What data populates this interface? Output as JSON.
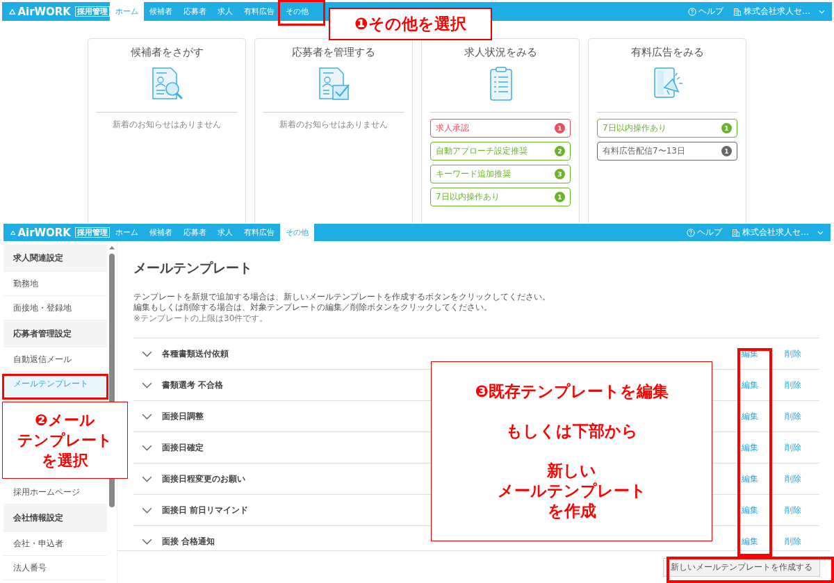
{
  "top_screen": {
    "header": {
      "logo": "AirWORK",
      "badge": "採用管理",
      "tabs": [
        {
          "label": "ホーム",
          "selected": true
        },
        {
          "label": "候補者",
          "selected": false
        },
        {
          "label": "応募者",
          "selected": false
        },
        {
          "label": "求人",
          "selected": false
        },
        {
          "label": "有料広告",
          "selected": false
        },
        {
          "label": "その他",
          "selected": false
        }
      ],
      "help": "ヘルプ",
      "account": "株式会社求人セ…"
    },
    "cards": [
      {
        "title": "候補者をさがす",
        "notice": "新着のお知らせはありません"
      },
      {
        "title": "応募者を管理する",
        "notice": "新着のお知らせはありません"
      },
      {
        "title": "求人状況をみる",
        "items": [
          {
            "label": "求人承認",
            "count": "1",
            "color": "#e8505b"
          },
          {
            "label": "自動アプローチ設定推奨",
            "count": "2",
            "color": "#6ab42d"
          },
          {
            "label": "キーワード追加推奨",
            "count": "3",
            "color": "#6ab42d"
          },
          {
            "label": "7日以内操作あり",
            "count": "1",
            "color": "#6ab42d"
          }
        ]
      },
      {
        "title": "有料広告をみる",
        "items": [
          {
            "label": "7日以内操作あり",
            "count": "1",
            "color": "#6ab42d"
          },
          {
            "label": "有料広告配信7〜13日",
            "count": "1",
            "color": "#666666"
          }
        ]
      }
    ]
  },
  "bottom_screen": {
    "header": {
      "logo": "AirWORK",
      "badge": "採用管理",
      "tabs": [
        {
          "label": "ホーム",
          "selected": false
        },
        {
          "label": "候補者",
          "selected": false
        },
        {
          "label": "応募者",
          "selected": false
        },
        {
          "label": "求人",
          "selected": false
        },
        {
          "label": "有料広告",
          "selected": false
        },
        {
          "label": "その他",
          "selected": true
        }
      ],
      "help": "ヘルプ",
      "account": "株式会社求人セ…"
    },
    "sidebar": [
      {
        "heading": "求人関連設定",
        "items": [
          {
            "label": "勤務地",
            "selected": false
          },
          {
            "label": "面接地・登録地",
            "selected": false
          }
        ]
      },
      {
        "heading": "応募者管理設定",
        "items": [
          {
            "label": "自動返信メール",
            "selected": false
          },
          {
            "label": "メールテンプレート",
            "selected": true
          },
          {
            "label": "採用ホームページ",
            "selected": false
          }
        ]
      },
      {
        "heading": "会社情報設定",
        "items": [
          {
            "label": "会社・申込者",
            "selected": false
          },
          {
            "label": "法人番号",
            "selected": false
          }
        ]
      }
    ],
    "title": "メールテンプレート",
    "description": [
      "テンプレートを新規で追加する場合は、新しいメールテンプレートを作成するボタンをクリックしてください。",
      "編集もしくは削除する場合は、対象テンプレートの編集／削除ボタンをクリックしてください。"
    ],
    "note": "※テンプレートの上限は30件です。",
    "templates": [
      {
        "name": "各種書類送付依頼",
        "edit": "編集",
        "delete": "削除"
      },
      {
        "name": "書類選考 不合格",
        "edit": "編集",
        "delete": "削除"
      },
      {
        "name": "面接日調整",
        "edit": "編集",
        "delete": "削除"
      },
      {
        "name": "面接日確定",
        "edit": "編集",
        "delete": "削除"
      },
      {
        "name": "面接日程変更のお願い",
        "edit": "編集",
        "delete": "削除"
      },
      {
        "name": "面接日 前日リマインド",
        "edit": "編集",
        "delete": "削除"
      },
      {
        "name": "面接 合格通知",
        "edit": "編集",
        "delete": "削除"
      }
    ],
    "new_button": "新しいメールテンプレートを作成する"
  },
  "annotations": [
    {
      "paragraphs": [
        [
          "❶その他を選択"
        ]
      ]
    },
    {
      "paragraphs": [
        [
          "❷メール",
          "テンプレート",
          "を選択"
        ]
      ]
    },
    {
      "paragraphs": [
        [
          "❸既存テンプレートを編集"
        ],
        [
          "もしくは下部から"
        ],
        [
          "新しい",
          "メールテンプレート",
          "を作成"
        ]
      ]
    }
  ]
}
